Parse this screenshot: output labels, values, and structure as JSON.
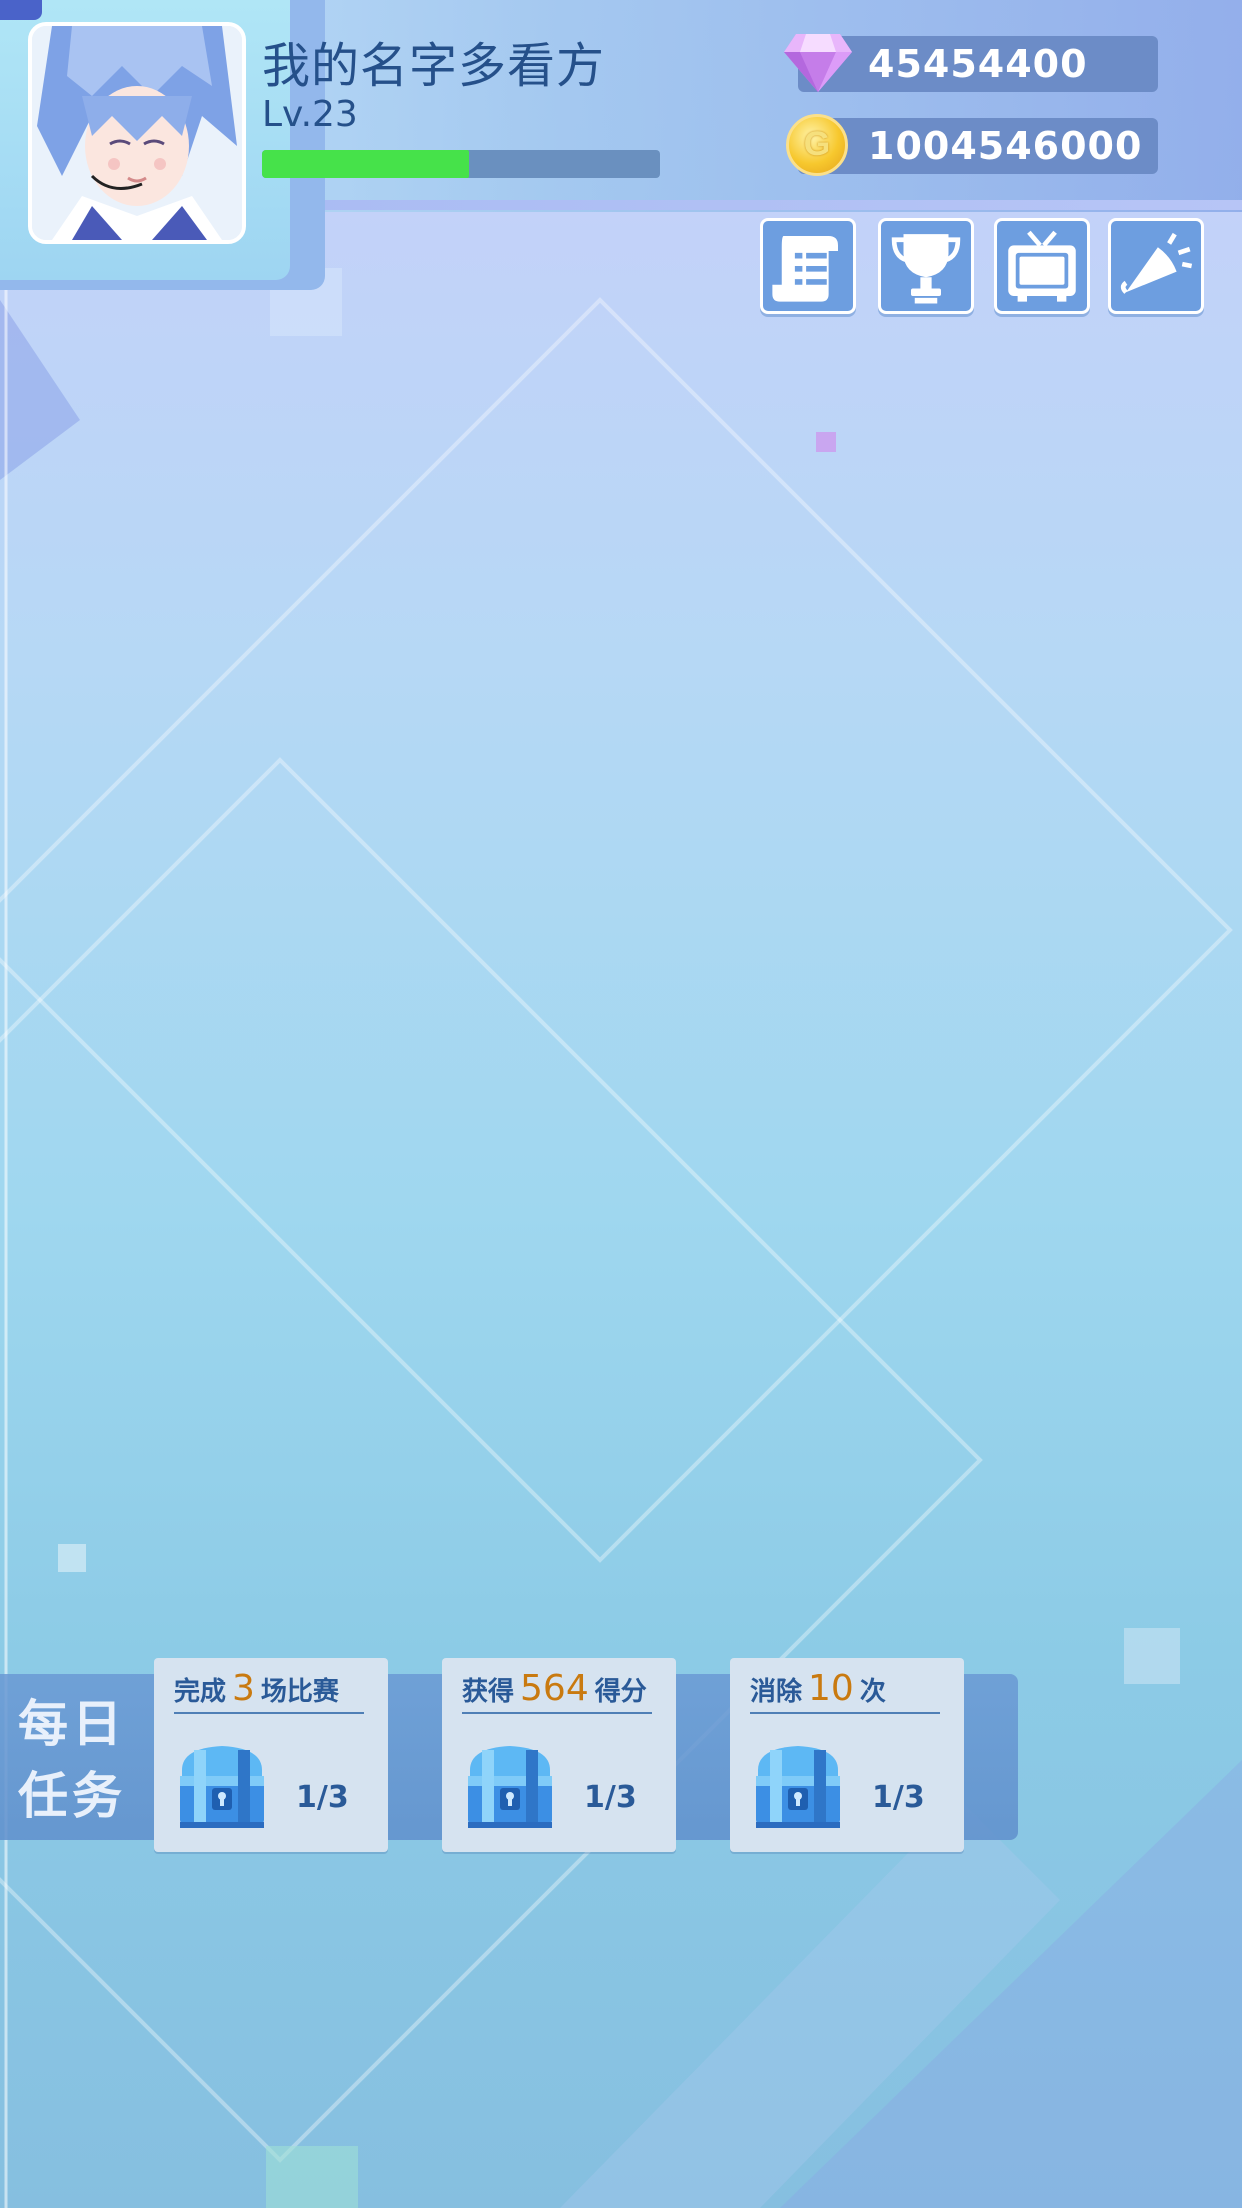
{
  "player": {
    "name": "我的名字多看方",
    "level": "Lv.23",
    "xp_fraction": 0.52
  },
  "currency": {
    "gems": "45454400",
    "coins": "1004546000",
    "coin_symbol": "G"
  },
  "menu": [
    {
      "name": "tasks-scroll-icon"
    },
    {
      "name": "trophy-icon"
    },
    {
      "name": "tv-icon"
    },
    {
      "name": "megaphone-icon"
    }
  ],
  "daily_tasks": {
    "label_line1": "每日",
    "label_line2": "任务",
    "items": [
      {
        "pre": "完成",
        "num": "3",
        "post": "场比赛",
        "progress": "1/3"
      },
      {
        "pre": "获得",
        "num": "564",
        "post": "得分",
        "progress": "1/3"
      },
      {
        "pre": "消除",
        "num": "10",
        "post": "次",
        "progress": "1/3"
      }
    ]
  },
  "colors": {
    "accent_text": "#25508a",
    "xp_fill": "#46e24a",
    "task_number": "#c97a10"
  }
}
